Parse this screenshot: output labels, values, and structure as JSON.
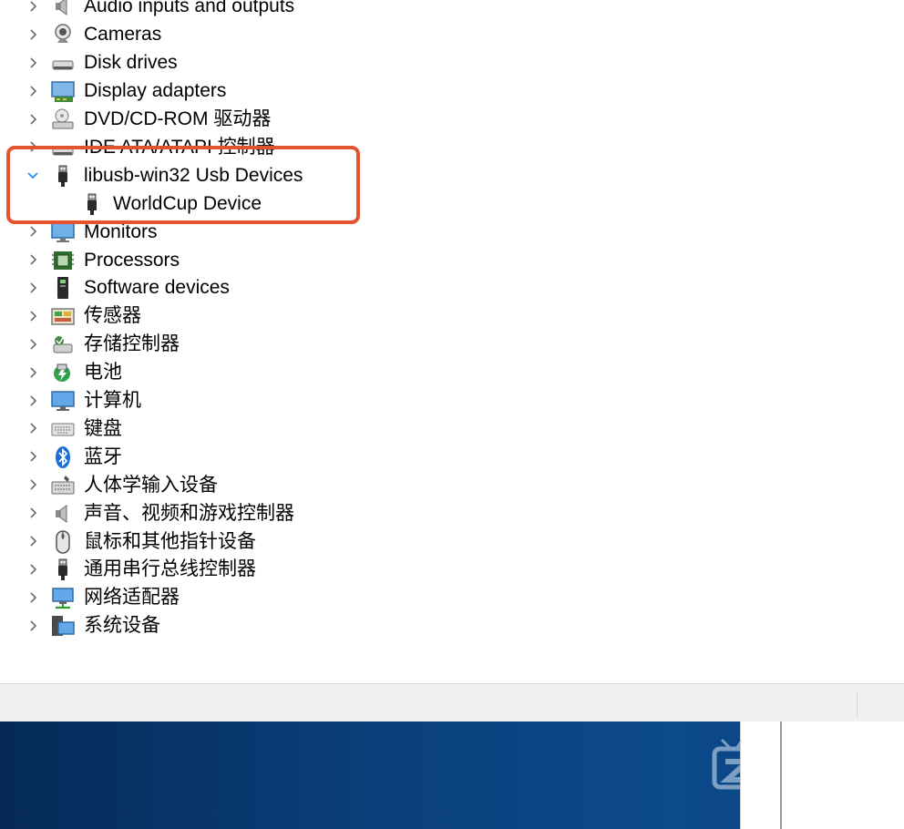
{
  "tree": {
    "items": [
      {
        "label": "Audio inputs and outputs",
        "icon": "speaker-icon",
        "expanded": false
      },
      {
        "label": "Cameras",
        "icon": "webcam-icon",
        "expanded": false
      },
      {
        "label": "Disk drives",
        "icon": "disk-drive-icon",
        "expanded": false
      },
      {
        "label": "Display adapters",
        "icon": "display-adapter-icon",
        "expanded": false
      },
      {
        "label": "DVD/CD-ROM 驱动器",
        "icon": "cd-drive-icon",
        "expanded": false
      },
      {
        "label": "IDE ATA/ATAPI 控制器",
        "icon": "ide-controller-icon",
        "expanded": false
      },
      {
        "label": "libusb-win32 Usb Devices",
        "icon": "usb-plug-icon",
        "expanded": true
      },
      {
        "label": "WorldCup Device",
        "icon": "usb-plug-icon",
        "child": true
      },
      {
        "label": "Monitors",
        "icon": "monitor-icon",
        "expanded": false
      },
      {
        "label": "Processors",
        "icon": "processor-icon",
        "expanded": false
      },
      {
        "label": "Software devices",
        "icon": "software-device-icon",
        "expanded": false
      },
      {
        "label": "传感器",
        "icon": "sensor-icon",
        "expanded": false
      },
      {
        "label": "存储控制器",
        "icon": "storage-controller-icon",
        "expanded": false
      },
      {
        "label": "电池",
        "icon": "battery-icon",
        "expanded": false
      },
      {
        "label": "计算机",
        "icon": "computer-icon",
        "expanded": false
      },
      {
        "label": "键盘",
        "icon": "keyboard-icon",
        "expanded": false
      },
      {
        "label": "蓝牙",
        "icon": "bluetooth-icon",
        "expanded": false
      },
      {
        "label": "人体学输入设备",
        "icon": "hid-icon",
        "expanded": false
      },
      {
        "label": "声音、视频和游戏控制器",
        "icon": "speaker-icon",
        "expanded": false
      },
      {
        "label": "鼠标和其他指针设备",
        "icon": "mouse-icon",
        "expanded": false
      },
      {
        "label": "通用串行总线控制器",
        "icon": "usb-plug-icon",
        "expanded": false
      },
      {
        "label": "网络适配器",
        "icon": "network-adapter-icon",
        "expanded": false
      },
      {
        "label": "系统设备",
        "icon": "system-device-icon",
        "expanded": false
      }
    ]
  },
  "colors": {
    "highlight": "#e4532f",
    "chevron_collapsed": "#6b6b6b",
    "chevron_expanded": "#1e90ff",
    "desktop": "#0a3f7a"
  }
}
